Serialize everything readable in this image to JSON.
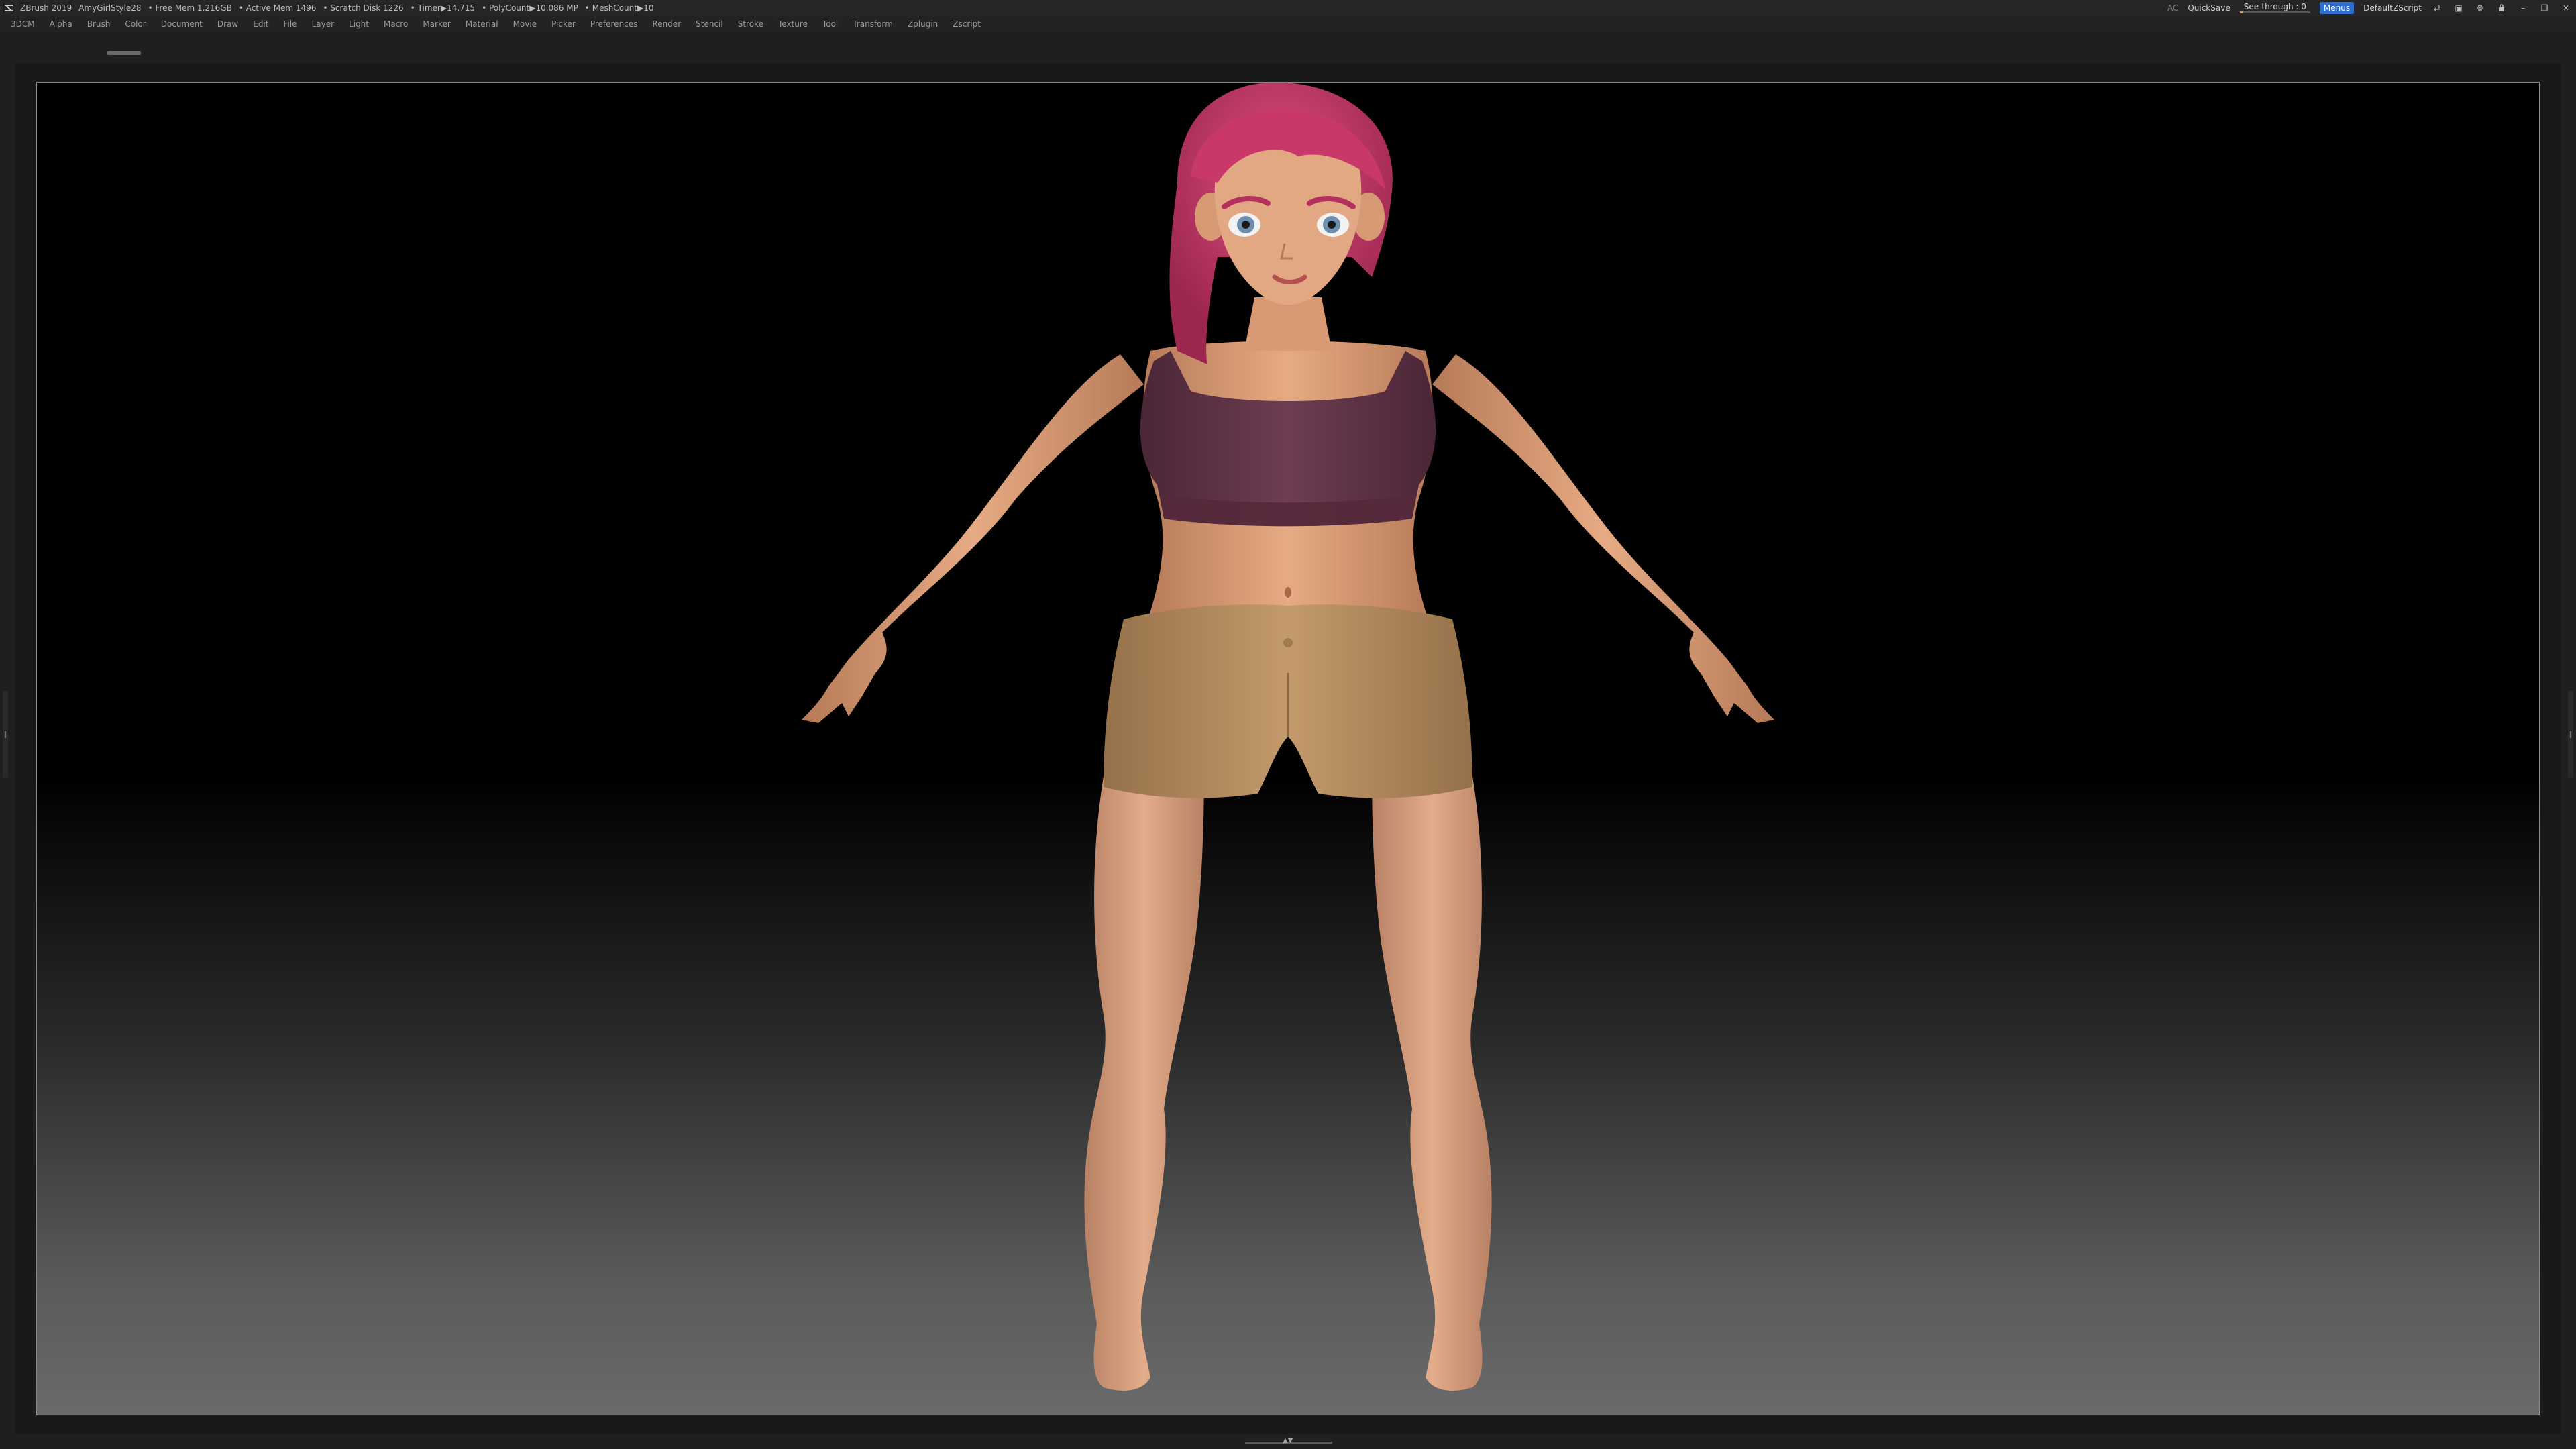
{
  "titlebar": {
    "app_name": "ZBrush 2019",
    "doc_name": "AmyGirlStyle28",
    "free_mem": "• Free Mem 1.216GB",
    "active_mem": "• Active Mem 1496",
    "scratch_disk": "• Scratch Disk 1226",
    "timer": "• Timer▶14.715",
    "polycount": "• PolyCount▶10.086 MP",
    "meshcount": "• MeshCount▶10",
    "ac_label": "AC",
    "quicksave_label": "QuickSave",
    "seethrough_label": "See-through",
    "seethrough_value": "0",
    "menus_label": "Menus",
    "script_label": "DefaultZScript"
  },
  "menubar": {
    "items": [
      {
        "label": "3DCM"
      },
      {
        "label": "Alpha"
      },
      {
        "label": "Brush"
      },
      {
        "label": "Color"
      },
      {
        "label": "Document"
      },
      {
        "label": "Draw"
      },
      {
        "label": "Edit"
      },
      {
        "label": "File"
      },
      {
        "label": "Layer"
      },
      {
        "label": "Light"
      },
      {
        "label": "Macro"
      },
      {
        "label": "Marker"
      },
      {
        "label": "Material"
      },
      {
        "label": "Movie"
      },
      {
        "label": "Picker"
      },
      {
        "label": "Preferences"
      },
      {
        "label": "Render"
      },
      {
        "label": "Stencil"
      },
      {
        "label": "Stroke"
      },
      {
        "label": "Texture"
      },
      {
        "label": "Tool"
      },
      {
        "label": "Transform"
      },
      {
        "label": "Zplugin"
      },
      {
        "label": "Zscript"
      }
    ]
  },
  "icons": {
    "window_controls": [
      "layout-icon",
      "layout-alt-icon",
      "settings-icon",
      "lock-icon",
      "minimize-icon",
      "restore-icon",
      "close-icon"
    ]
  },
  "colors": {
    "hair": "#c8396a",
    "skin": "#e0a27a",
    "top": "#5f3446",
    "shorts": "#b88c5f",
    "menus_button": "#2d6ecf",
    "accent": "#e8a33c"
  }
}
